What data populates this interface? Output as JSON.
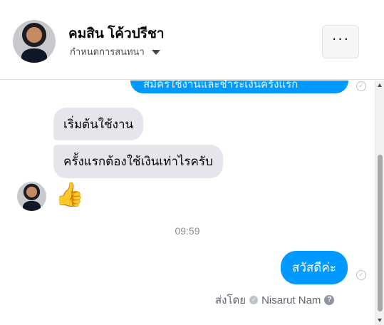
{
  "header": {
    "contact_name": "คมสิน โค้วปรีชา",
    "conversation_settings_label": "กำหนดการสนทนา",
    "more_button_label": "···"
  },
  "thread": {
    "partial_outgoing_text": "สมัครใช้งานและชำระเงินครั้งแรก",
    "incoming_messages": [
      {
        "text": "เริ่มต้นใช้งาน"
      },
      {
        "text": "ครั้งแรกต้องใช้เงินเท่าไรครับ"
      }
    ],
    "reaction": "👍",
    "timestamp": "09:59",
    "outgoing_message": "สวัสดีค่ะ",
    "sent_by_label": "ส่งโดย",
    "sender_name": "Nisarut Nam"
  },
  "icons": {
    "seen": "check-circle-icon",
    "like": "thumbs-up-icon",
    "help": "question-icon",
    "caret": "caret-down-icon",
    "more": "more-dots-icon"
  },
  "colors": {
    "outgoing_bubble": "#0099ff",
    "incoming_bubble": "#e4e6eb",
    "like": "#f5b400"
  }
}
